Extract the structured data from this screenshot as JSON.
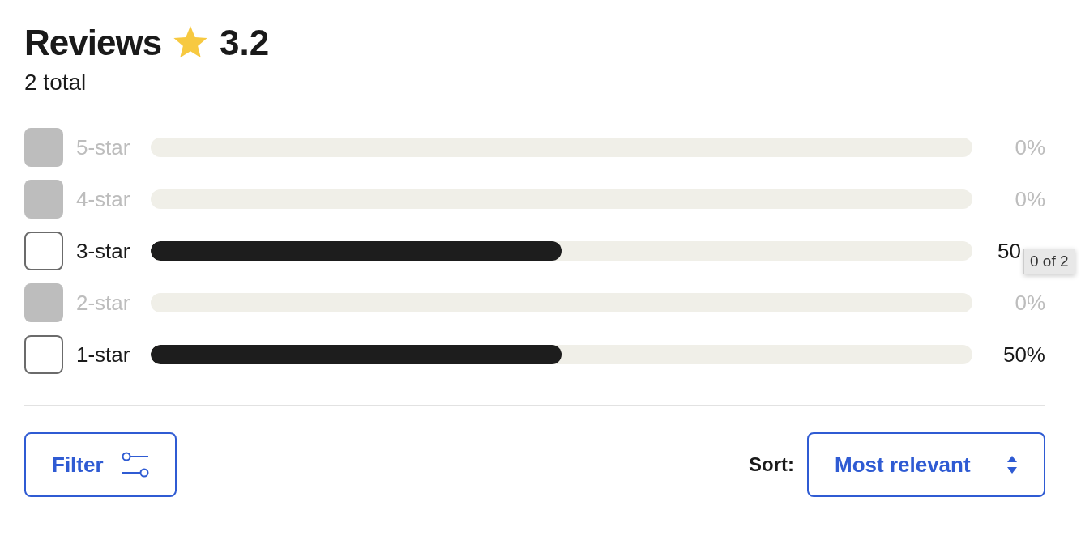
{
  "header": {
    "title": "Reviews",
    "rating": "3.2",
    "total": "2 total"
  },
  "breakdown": [
    {
      "label": "5-star",
      "disabled": true,
      "checked": false,
      "level": 0,
      "reading": "0%"
    },
    {
      "label": "4-star",
      "disabled": true,
      "checked": false,
      "level": 0,
      "reading": "0%"
    },
    {
      "label": "3-star",
      "disabled": false,
      "checked": false,
      "level": 0.5,
      "reading": "50",
      "tooltip": "0 of 2"
    },
    {
      "label": "2-star",
      "disabled": true,
      "checked": false,
      "level": 0,
      "reading": "0%"
    },
    {
      "label": "1-star",
      "disabled": false,
      "checked": false,
      "level": 0.5,
      "reading": "50%"
    }
  ],
  "filter_button": {
    "label": "Filter"
  },
  "sort": {
    "label": "Sort:",
    "value": "Most relevant"
  }
}
